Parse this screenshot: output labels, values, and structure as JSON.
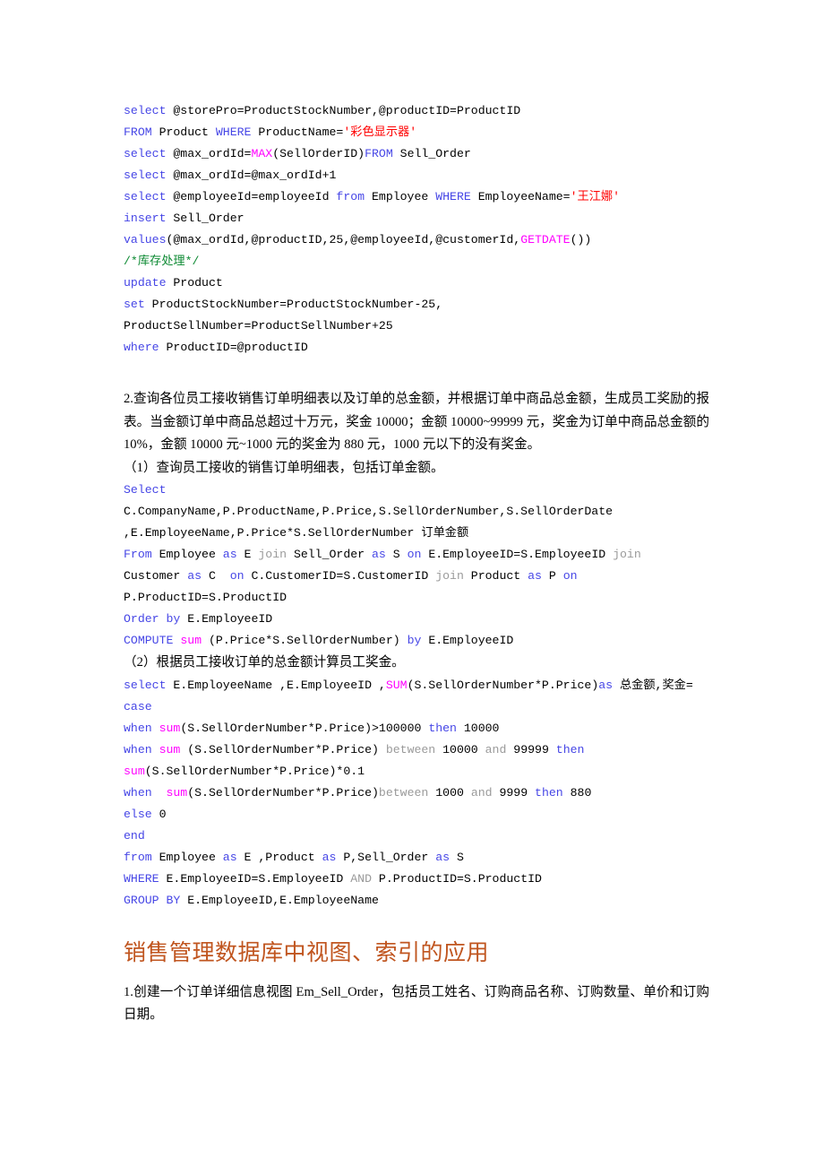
{
  "document": {
    "page_background": "#ffffff",
    "colors": {
      "keyword": "#4646E6",
      "keyword_secondary": "#9a9a9a",
      "function": "#FF00FF",
      "string": "#FF0000",
      "comment": "#0d8a33",
      "heading": "#C0551F",
      "body_text": "#000000"
    }
  },
  "code_block_1": {
    "lines": [
      [
        {
          "t": "select",
          "c": "k"
        },
        {
          "t": " @storePro=ProductStockNumber,@productID=ProductID",
          "c": "pl"
        }
      ],
      [
        {
          "t": "FROM",
          "c": "k"
        },
        {
          "t": " Product ",
          "c": "pl"
        },
        {
          "t": "WHERE",
          "c": "k"
        },
        {
          "t": " ProductName=",
          "c": "pl"
        },
        {
          "t": "'彩色显示器'",
          "c": "st"
        }
      ],
      [
        {
          "t": "select",
          "c": "k"
        },
        {
          "t": " @max_ordId=",
          "c": "pl"
        },
        {
          "t": "MAX",
          "c": "fn"
        },
        {
          "t": "(SellOrderID)",
          "c": "pl"
        },
        {
          "t": "FROM",
          "c": "k"
        },
        {
          "t": " Sell_Order",
          "c": "pl"
        }
      ],
      [
        {
          "t": "select",
          "c": "k"
        },
        {
          "t": " @max_ordId=@max_ordId+1",
          "c": "pl"
        }
      ],
      [
        {
          "t": "select",
          "c": "k"
        },
        {
          "t": " @employeeId=employeeId ",
          "c": "pl"
        },
        {
          "t": "from",
          "c": "k"
        },
        {
          "t": " Employee ",
          "c": "pl"
        },
        {
          "t": "WHERE",
          "c": "k"
        },
        {
          "t": " EmployeeName=",
          "c": "pl"
        },
        {
          "t": "'王江娜'",
          "c": "st"
        }
      ],
      [
        {
          "t": "insert",
          "c": "k"
        },
        {
          "t": " Sell_Order",
          "c": "pl"
        }
      ],
      [
        {
          "t": "values",
          "c": "k"
        },
        {
          "t": "(@max_ordId,@productID,25,@employeeId,@customerId,",
          "c": "pl"
        },
        {
          "t": "GETDATE",
          "c": "fn"
        },
        {
          "t": "())",
          "c": "pl"
        }
      ],
      [
        {
          "t": "/*库存处理*/",
          "c": "cm"
        }
      ],
      [
        {
          "t": "update",
          "c": "k"
        },
        {
          "t": " Product",
          "c": "pl"
        }
      ],
      [
        {
          "t": "set",
          "c": "k"
        },
        {
          "t": " ProductStockNumber=ProductStockNumber-25,",
          "c": "pl"
        }
      ],
      [
        {
          "t": "ProductSellNumber=ProductSellNumber+25",
          "c": "pl"
        }
      ],
      [
        {
          "t": "where",
          "c": "k"
        },
        {
          "t": " ProductID=@productID",
          "c": "pl"
        }
      ]
    ]
  },
  "paragraph_2": {
    "text": "2.查询各位员工接收销售订单明细表以及订单的总金额，并根据订单中商品总金额，生成员工奖励的报表。当金额订单中商品总超过十万元，奖金 10000；金额 10000~99999 元，奖金为订单中商品总金额的 10%，金额 10000 元~1000 元的奖金为 880 元，1000 元以下的没有奖金。"
  },
  "paragraph_2_1": {
    "text": "（1）查询员工接收的销售订单明细表，包括订单金额。"
  },
  "code_block_2": {
    "lines": [
      [
        {
          "t": "Select",
          "c": "k"
        }
      ],
      [
        {
          "t": "C.CompanyName,P.ProductName,P.Price,S.SellOrderNumber,S.SellOrderDate",
          "c": "pl"
        }
      ],
      [
        {
          "t": ",E.EmployeeName,P.Price*S.SellOrderNumber 订单金额",
          "c": "pl"
        }
      ],
      [
        {
          "t": "From",
          "c": "k"
        },
        {
          "t": " Employee ",
          "c": "pl"
        },
        {
          "t": "as",
          "c": "k"
        },
        {
          "t": " E ",
          "c": "pl"
        },
        {
          "t": "join",
          "c": "kg"
        },
        {
          "t": " Sell_Order ",
          "c": "pl"
        },
        {
          "t": "as",
          "c": "k"
        },
        {
          "t": " S ",
          "c": "pl"
        },
        {
          "t": "on",
          "c": "k"
        },
        {
          "t": " E.EmployeeID=S.EmployeeID ",
          "c": "pl"
        },
        {
          "t": "join",
          "c": "kg"
        }
      ],
      [
        {
          "t": "Customer ",
          "c": "pl"
        },
        {
          "t": "as",
          "c": "k"
        },
        {
          "t": " C  ",
          "c": "pl"
        },
        {
          "t": "on",
          "c": "k"
        },
        {
          "t": " C.CustomerID=S.CustomerID ",
          "c": "pl"
        },
        {
          "t": "join",
          "c": "kg"
        },
        {
          "t": " Product ",
          "c": "pl"
        },
        {
          "t": "as",
          "c": "k"
        },
        {
          "t": " P ",
          "c": "pl"
        },
        {
          "t": "on",
          "c": "k"
        }
      ],
      [
        {
          "t": "P.ProductID=S.ProductID",
          "c": "pl"
        }
      ],
      [
        {
          "t": "Order",
          "c": "k"
        },
        {
          "t": " ",
          "c": "pl"
        },
        {
          "t": "by",
          "c": "k"
        },
        {
          "t": " E.EmployeeID",
          "c": "pl"
        }
      ],
      [
        {
          "t": "COMPUTE",
          "c": "k"
        },
        {
          "t": " ",
          "c": "pl"
        },
        {
          "t": "sum",
          "c": "fn"
        },
        {
          "t": " (P.Price*S.SellOrderNumber) ",
          "c": "pl"
        },
        {
          "t": "by",
          "c": "k"
        },
        {
          "t": " E.EmployeeID",
          "c": "pl"
        }
      ]
    ]
  },
  "paragraph_2_2": {
    "text": "（2）根据员工接收订单的总金额计算员工奖金。"
  },
  "code_block_3": {
    "lines": [
      [
        {
          "t": "select",
          "c": "k"
        },
        {
          "t": " E.EmployeeName ,E.EmployeeID ,",
          "c": "pl"
        },
        {
          "t": "SUM",
          "c": "fn"
        },
        {
          "t": "(S.SellOrderNumber*P.Price)",
          "c": "pl"
        },
        {
          "t": "as",
          "c": "k"
        },
        {
          "t": " 总金额,奖金=",
          "c": "pl"
        }
      ],
      [
        {
          "t": "case",
          "c": "k"
        }
      ],
      [
        {
          "t": "when",
          "c": "k"
        },
        {
          "t": " ",
          "c": "pl"
        },
        {
          "t": "sum",
          "c": "fn"
        },
        {
          "t": "(S.SellOrderNumber*P.Price)>100000 ",
          "c": "pl"
        },
        {
          "t": "then",
          "c": "k"
        },
        {
          "t": " 10000",
          "c": "pl"
        }
      ],
      [
        {
          "t": "when",
          "c": "k"
        },
        {
          "t": " ",
          "c": "pl"
        },
        {
          "t": "sum",
          "c": "fn"
        },
        {
          "t": " (S.SellOrderNumber*P.Price) ",
          "c": "pl"
        },
        {
          "t": "between",
          "c": "kg"
        },
        {
          "t": " 10000 ",
          "c": "pl"
        },
        {
          "t": "and",
          "c": "kg"
        },
        {
          "t": " 99999 ",
          "c": "pl"
        },
        {
          "t": "then",
          "c": "k"
        }
      ],
      [
        {
          "t": "sum",
          "c": "fn"
        },
        {
          "t": "(S.SellOrderNumber*P.Price)*0.1",
          "c": "pl"
        }
      ],
      [
        {
          "t": "when",
          "c": "k"
        },
        {
          "t": "  ",
          "c": "pl"
        },
        {
          "t": "sum",
          "c": "fn"
        },
        {
          "t": "(S.SellOrderNumber*P.Price)",
          "c": "pl"
        },
        {
          "t": "between",
          "c": "kg"
        },
        {
          "t": " 1000 ",
          "c": "pl"
        },
        {
          "t": "and",
          "c": "kg"
        },
        {
          "t": " 9999 ",
          "c": "pl"
        },
        {
          "t": "then",
          "c": "k"
        },
        {
          "t": " 880",
          "c": "pl"
        }
      ],
      [
        {
          "t": "else",
          "c": "k"
        },
        {
          "t": " 0",
          "c": "pl"
        }
      ],
      [
        {
          "t": "end",
          "c": "k"
        }
      ],
      [
        {
          "t": "from",
          "c": "k"
        },
        {
          "t": " Employee ",
          "c": "pl"
        },
        {
          "t": "as",
          "c": "k"
        },
        {
          "t": " E ,Product ",
          "c": "pl"
        },
        {
          "t": "as",
          "c": "k"
        },
        {
          "t": " P,Sell_Order ",
          "c": "pl"
        },
        {
          "t": "as",
          "c": "k"
        },
        {
          "t": " S",
          "c": "pl"
        }
      ],
      [
        {
          "t": "WHERE",
          "c": "k"
        },
        {
          "t": " E.EmployeeID=S.EmployeeID ",
          "c": "pl"
        },
        {
          "t": "AND",
          "c": "kg"
        },
        {
          "t": " P.ProductID=S.ProductID",
          "c": "pl"
        }
      ],
      [
        {
          "t": "GROUP BY",
          "c": "k"
        },
        {
          "t": " E.EmployeeID,E.EmployeeName",
          "c": "pl"
        }
      ]
    ]
  },
  "section_heading": {
    "text": "销售管理数据库中视图、索引的应用"
  },
  "paragraph_3": {
    "text": "1.创建一个订单详细信息视图 Em_Sell_Order，包括员工姓名、订购商品名称、订购数量、单价和订购日期。"
  }
}
